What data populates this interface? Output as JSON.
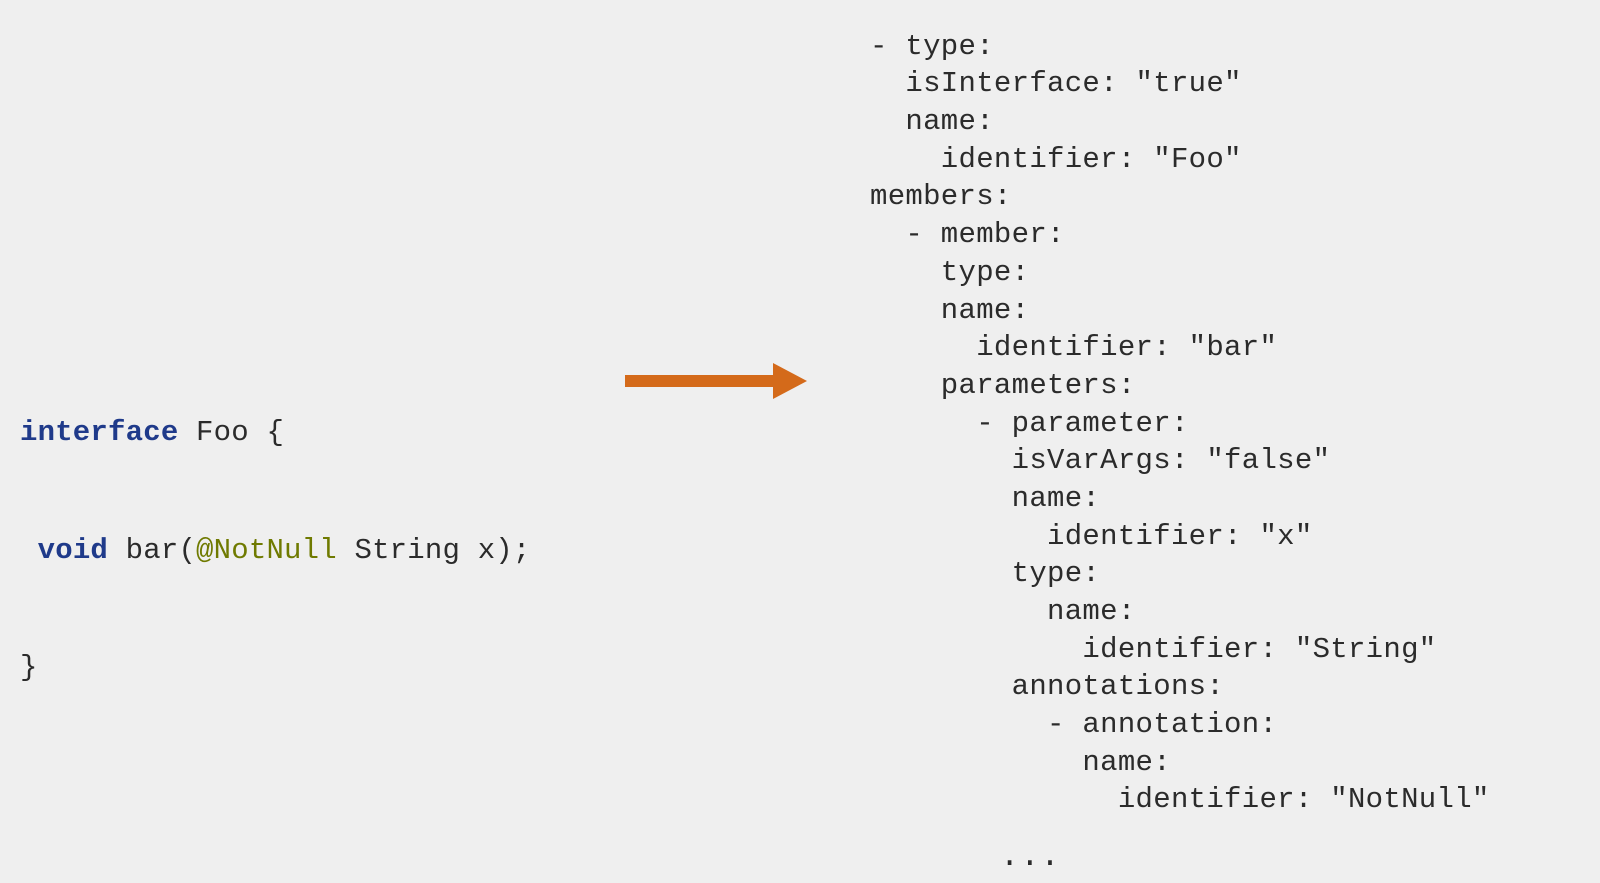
{
  "code": {
    "line1": {
      "kw": "interface",
      "rest": " Foo {"
    },
    "line2": {
      "indent": " ",
      "kw": "void",
      "mid": " bar(",
      "ann": "@NotNull",
      "rest": " String x);"
    },
    "line3": "}"
  },
  "ellipsis": "...",
  "yaml": {
    "l00": "- type:",
    "l01": "  isInterface: \"true\"",
    "l02": "  name:",
    "l03": "    identifier: \"Foo\"",
    "l04": "members:",
    "l05": "  - member:",
    "l06": "    type:",
    "l07": "    name:",
    "l08": "      identifier: \"bar\"",
    "l09": "    parameters:",
    "l10": "      - parameter:",
    "l11": "        isVarArgs: \"false\"",
    "l12": "        name:",
    "l13": "          identifier: \"x\"",
    "l14": "        type:",
    "l15": "          name:",
    "l16": "            identifier: \"String\"",
    "l17": "        annotations:",
    "l18": "          - annotation:",
    "l19": "            name:",
    "l20": "              identifier: \"NotNull\""
  }
}
